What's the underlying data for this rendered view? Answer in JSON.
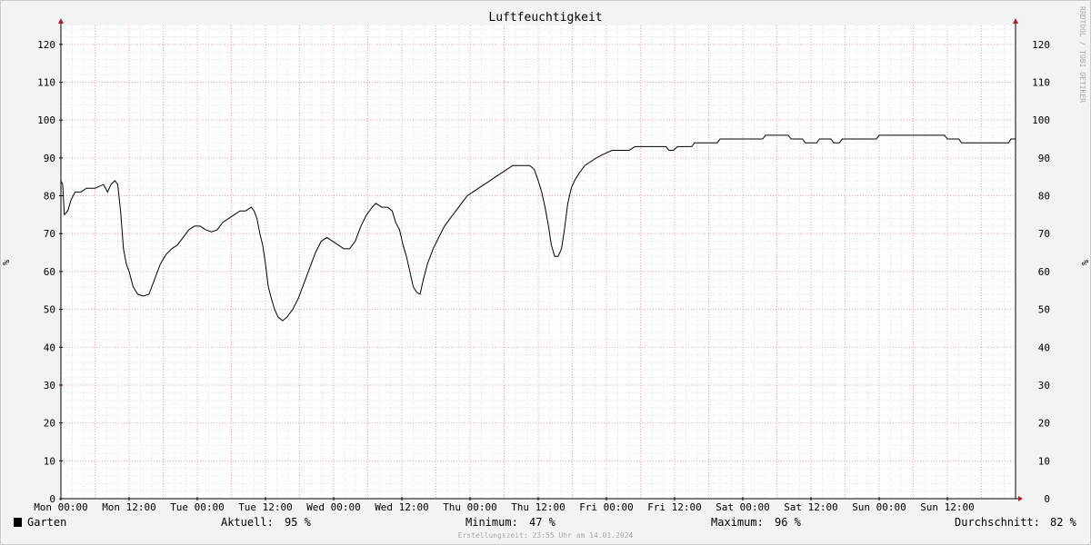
{
  "chart_data": {
    "type": "line",
    "title": "Luftfeuchtigkeit",
    "ylabel": "%",
    "ylim": [
      0,
      125
    ],
    "yticks": [
      0,
      10,
      20,
      30,
      40,
      50,
      60,
      70,
      80,
      90,
      100,
      110,
      120
    ],
    "xlim_hours": [
      0,
      168
    ],
    "xticks": [
      {
        "h": 0,
        "label": "Mon 00:00"
      },
      {
        "h": 12,
        "label": "Mon 12:00"
      },
      {
        "h": 24,
        "label": "Tue 00:00"
      },
      {
        "h": 36,
        "label": "Tue 12:00"
      },
      {
        "h": 48,
        "label": "Wed 00:00"
      },
      {
        "h": 60,
        "label": "Wed 12:00"
      },
      {
        "h": 72,
        "label": "Thu 00:00"
      },
      {
        "h": 84,
        "label": "Thu 12:00"
      },
      {
        "h": 96,
        "label": "Fri 00:00"
      },
      {
        "h": 108,
        "label": "Fri 12:00"
      },
      {
        "h": 120,
        "label": "Sat 00:00"
      },
      {
        "h": 132,
        "label": "Sat 12:00"
      },
      {
        "h": 144,
        "label": "Sun 00:00"
      },
      {
        "h": 156,
        "label": "Sun 12:00"
      }
    ],
    "grid": true,
    "series": [
      {
        "name": "Garten",
        "color": "#000000",
        "points": [
          [
            0,
            84
          ],
          [
            0.3,
            83
          ],
          [
            0.6,
            75
          ],
          [
            1.2,
            76
          ],
          [
            1.8,
            79
          ],
          [
            2.5,
            81
          ],
          [
            3.5,
            81
          ],
          [
            4.5,
            82
          ],
          [
            6,
            82
          ],
          [
            7.5,
            83
          ],
          [
            8.2,
            81
          ],
          [
            8.8,
            83
          ],
          [
            9.5,
            84
          ],
          [
            10,
            83
          ],
          [
            10.5,
            76
          ],
          [
            11,
            66
          ],
          [
            11.5,
            62
          ],
          [
            12,
            60
          ],
          [
            12.7,
            56
          ],
          [
            13.5,
            54
          ],
          [
            14.5,
            53.5
          ],
          [
            15.5,
            54
          ],
          [
            16.5,
            58
          ],
          [
            17.5,
            62
          ],
          [
            18.5,
            64.5
          ],
          [
            19.5,
            66
          ],
          [
            20.5,
            67
          ],
          [
            21.5,
            69
          ],
          [
            22.5,
            71
          ],
          [
            23.5,
            72
          ],
          [
            24.5,
            72
          ],
          [
            25.5,
            71
          ],
          [
            26.5,
            70.5
          ],
          [
            27.5,
            71
          ],
          [
            28.5,
            73
          ],
          [
            29.5,
            74
          ],
          [
            30.5,
            75
          ],
          [
            31.5,
            76
          ],
          [
            32.5,
            76
          ],
          [
            33.5,
            77
          ],
          [
            34,
            76
          ],
          [
            34.5,
            74
          ],
          [
            35,
            70
          ],
          [
            35.5,
            67
          ],
          [
            36,
            62
          ],
          [
            36.5,
            56
          ],
          [
            37,
            53
          ],
          [
            37.6,
            50
          ],
          [
            38.2,
            48
          ],
          [
            39,
            47
          ],
          [
            39.8,
            48
          ],
          [
            40.8,
            50
          ],
          [
            41.8,
            53
          ],
          [
            42.8,
            57
          ],
          [
            43.8,
            61
          ],
          [
            44.8,
            65
          ],
          [
            45.8,
            68
          ],
          [
            46.8,
            69
          ],
          [
            47.8,
            68
          ],
          [
            48.8,
            67
          ],
          [
            49.8,
            66
          ],
          [
            50.8,
            66
          ],
          [
            51.8,
            68
          ],
          [
            52.8,
            72
          ],
          [
            53.8,
            75
          ],
          [
            54.8,
            77
          ],
          [
            55.4,
            78
          ],
          [
            56.5,
            77
          ],
          [
            57.5,
            77
          ],
          [
            58.3,
            76
          ],
          [
            58.9,
            73
          ],
          [
            59.6,
            71
          ],
          [
            60.2,
            67
          ],
          [
            60.8,
            64
          ],
          [
            61.4,
            60
          ],
          [
            62,
            56
          ],
          [
            62.6,
            54.5
          ],
          [
            63.2,
            54
          ],
          [
            63.8,
            58
          ],
          [
            64.5,
            62
          ],
          [
            65.5,
            66
          ],
          [
            66.5,
            69
          ],
          [
            67.5,
            72
          ],
          [
            68.5,
            74
          ],
          [
            69.5,
            76
          ],
          [
            70.5,
            78
          ],
          [
            71.5,
            80
          ],
          [
            72.5,
            81
          ],
          [
            73.5,
            82
          ],
          [
            74.5,
            83
          ],
          [
            75.5,
            84
          ],
          [
            76.5,
            85
          ],
          [
            77.5,
            86
          ],
          [
            78.5,
            87
          ],
          [
            79.5,
            88
          ],
          [
            81,
            88
          ],
          [
            82.5,
            88
          ],
          [
            83.3,
            87
          ],
          [
            84,
            84
          ],
          [
            84.6,
            81
          ],
          [
            85.2,
            77
          ],
          [
            85.8,
            72
          ],
          [
            86.3,
            67
          ],
          [
            86.9,
            64
          ],
          [
            87.5,
            64
          ],
          [
            88.1,
            66
          ],
          [
            88.6,
            71
          ],
          [
            89.2,
            78
          ],
          [
            89.8,
            82
          ],
          [
            90.4,
            84
          ],
          [
            91.2,
            86
          ],
          [
            92.2,
            88
          ],
          [
            93.2,
            89
          ],
          [
            94.2,
            90
          ],
          [
            95.5,
            91
          ],
          [
            97,
            92
          ],
          [
            100,
            92
          ],
          [
            101,
            93
          ],
          [
            104,
            93
          ],
          [
            106.5,
            93
          ],
          [
            107,
            92
          ],
          [
            107.8,
            92
          ],
          [
            108.5,
            93
          ],
          [
            111,
            93
          ],
          [
            111.5,
            94
          ],
          [
            115.5,
            94
          ],
          [
            116,
            95
          ],
          [
            123.5,
            95
          ],
          [
            124,
            96
          ],
          [
            128,
            96
          ],
          [
            128.5,
            95
          ],
          [
            130.5,
            95
          ],
          [
            131,
            94
          ],
          [
            133,
            94
          ],
          [
            133.5,
            95
          ],
          [
            135.5,
            95
          ],
          [
            136,
            94
          ],
          [
            137,
            94
          ],
          [
            137.5,
            95
          ],
          [
            143.5,
            95
          ],
          [
            144,
            96
          ],
          [
            155.5,
            96
          ],
          [
            156,
            95
          ],
          [
            158,
            95
          ],
          [
            158.5,
            94
          ],
          [
            166.8,
            94
          ],
          [
            167.2,
            95
          ],
          [
            168,
            95
          ]
        ]
      }
    ],
    "legend": {
      "position": "bottom-left",
      "series_label": "Garten",
      "stats": [
        {
          "label": "Aktuell:",
          "value": "95 %"
        },
        {
          "label": "Minimum:",
          "value": "47 %"
        },
        {
          "label": "Maximum:",
          "value": "96 %"
        },
        {
          "label": "Durchschnitt:",
          "value": "82 %"
        }
      ]
    },
    "watermark": "RRDTOOL / TOBI OETIKER",
    "footer": "Erstellungszeit: 23:55 Uhr am 14.01.2024"
  },
  "colors": {
    "background": "#f3f3f3",
    "canvas": "#ffffff",
    "minor_grid": "#dddddd",
    "major_grid": "#e8a0a0",
    "axis": "#000000",
    "arrow": "#aa2222",
    "line": "#000000",
    "muted_text": "#aaaaaa"
  }
}
